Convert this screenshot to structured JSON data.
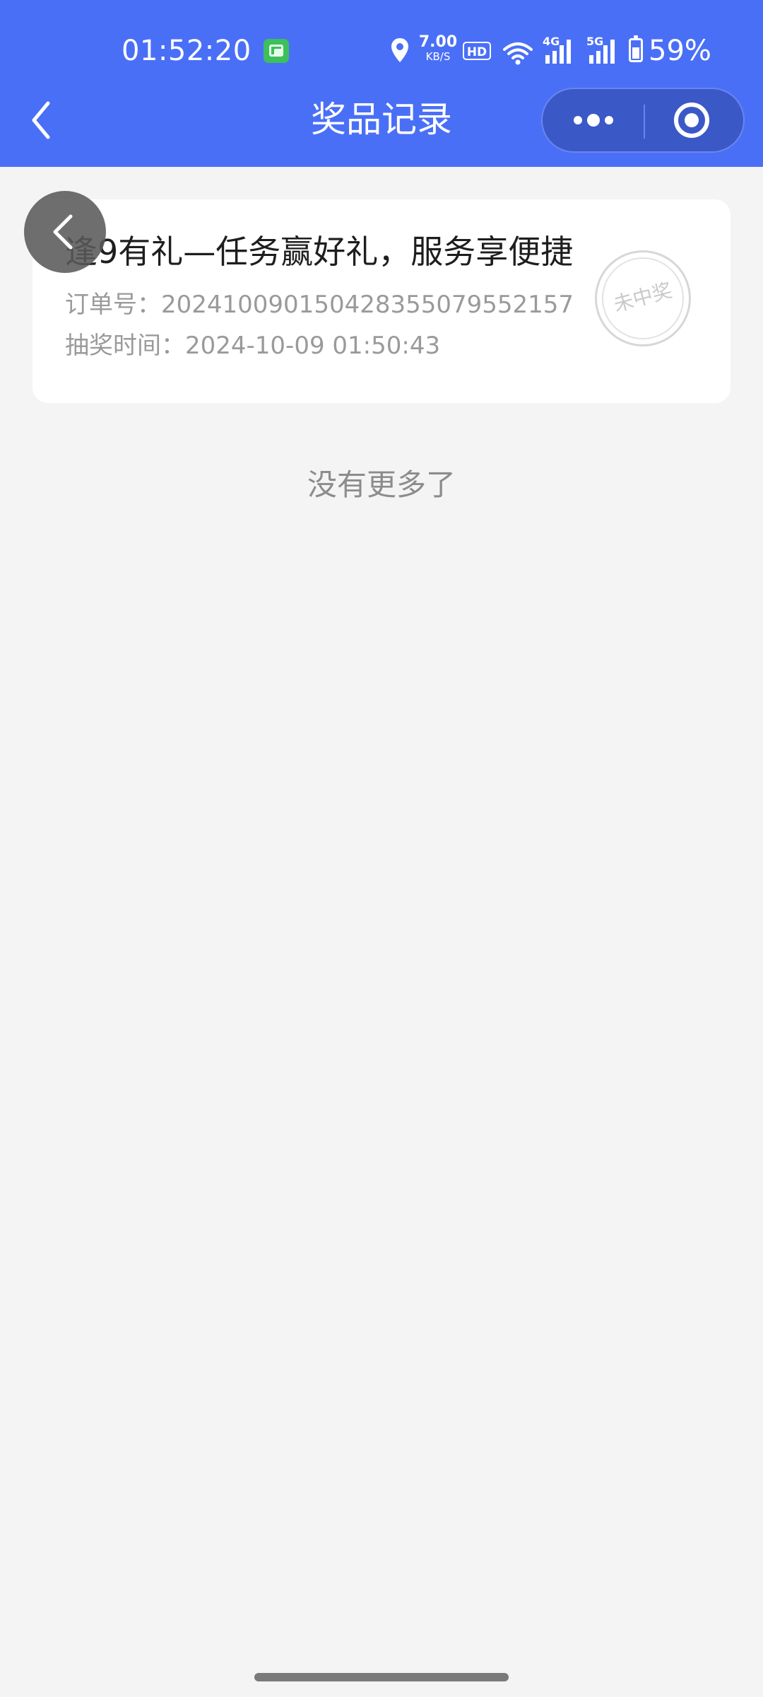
{
  "status_bar": {
    "time": "01:52:20",
    "net_speed_value": "7.00",
    "net_speed_unit": "KB/S",
    "hd_label": "HD",
    "net_4g_label": "4G",
    "net_5g_label": "5G",
    "battery": "59%"
  },
  "nav": {
    "title": "奖品记录",
    "more_icon": "more-dots-icon",
    "close_icon": "target-close-icon"
  },
  "records": [
    {
      "title": "逢9有礼—任务赢好礼，服务享便捷",
      "order_label": "订单号：",
      "order_no": "20241009015042835507955215 7",
      "time_label": "抽奖时间：",
      "time": "2024-10-09 01:50:43",
      "status_stamp": "未中奖"
    }
  ],
  "footer_text": "没有更多了",
  "colors": {
    "header_bg": "#4a6ff7",
    "page_bg": "#f4f4f4"
  }
}
